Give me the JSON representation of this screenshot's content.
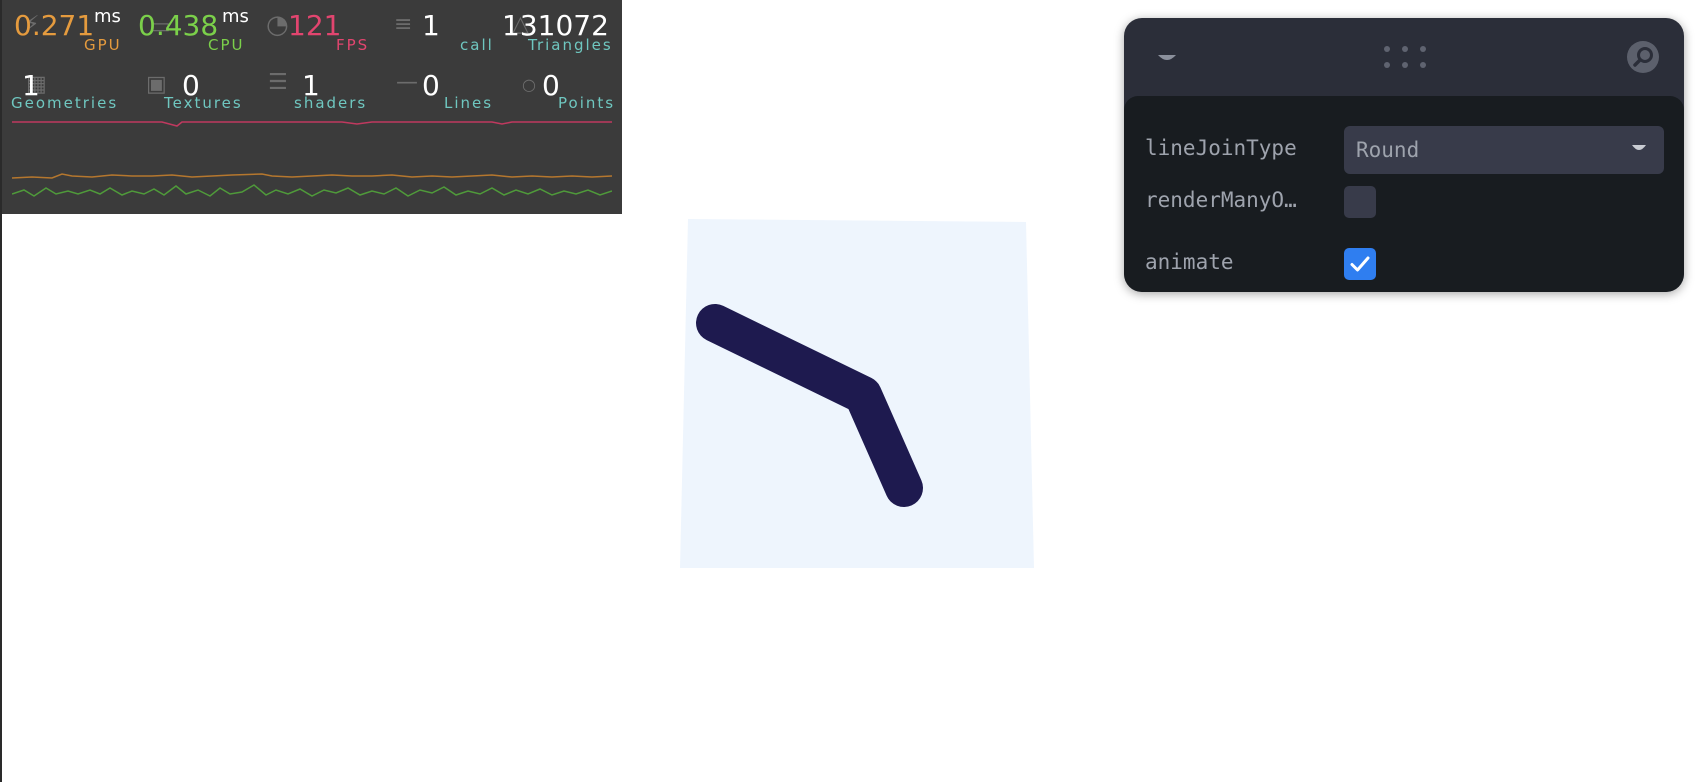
{
  "perf": {
    "gpu": {
      "value": "0.271",
      "unit": "ms",
      "label": "GPU",
      "color": "#e59b3e"
    },
    "cpu": {
      "value": "0.438",
      "unit": "ms",
      "label": "CPU",
      "color": "#7bd04a"
    },
    "fps": {
      "value": "121",
      "label": "FPS",
      "color": "#e2456f"
    },
    "calls": {
      "value": "1",
      "label": "call"
    },
    "triangles": {
      "value": "131072",
      "label": "Triangles"
    },
    "geometries": {
      "value": "1",
      "label": "Geometries"
    },
    "textures": {
      "value": "0",
      "label": "Textures"
    },
    "shaders": {
      "value": "1",
      "label": "shaders"
    },
    "lines": {
      "value": "0",
      "label": "Lines"
    },
    "points": {
      "value": "0",
      "label": "Points"
    },
    "label_color": "#6fc7c0"
  },
  "gui": {
    "controls": [
      {
        "label": "lineJoinType",
        "type": "select",
        "value": "Round"
      },
      {
        "label": "renderManyO…",
        "type": "checkbox",
        "checked": false
      },
      {
        "label": "animate",
        "type": "checkbox",
        "checked": true
      }
    ]
  },
  "scene": {
    "plane_color": "#eef5fd",
    "line_color": "#1e1a4f"
  }
}
